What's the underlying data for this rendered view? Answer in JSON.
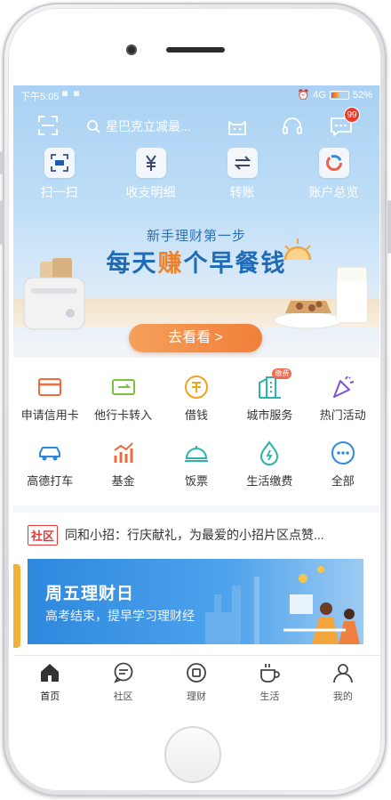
{
  "status_bar": {
    "time": "下午5:05",
    "network": "4G",
    "battery": "52%",
    "battery_level": 0.52
  },
  "header": {
    "search_placeholder": "星巴克立减最...",
    "message_badge": "99"
  },
  "quick_actions": [
    {
      "label": "扫一扫",
      "icon": "scan-card-icon"
    },
    {
      "label": "收支明细",
      "icon": "yuan-icon"
    },
    {
      "label": "转账",
      "icon": "transfer-arrows-icon"
    },
    {
      "label": "账户总览",
      "icon": "account-ring-icon"
    }
  ],
  "banner": {
    "subtitle": "新手理财第一步",
    "title_part1": "每天",
    "title_highlight": "赚",
    "title_part2": "个早餐钱",
    "cta": "去看看 >"
  },
  "services_row1": [
    {
      "label": "申请信用卡",
      "icon": "credit-card-icon",
      "color": "#f06a3c"
    },
    {
      "label": "他行卡转入",
      "icon": "card-transfer-icon",
      "color": "#7ac043"
    },
    {
      "label": "借钱",
      "icon": "borrow-icon",
      "color": "#f2a21c"
    },
    {
      "label": "城市服务",
      "icon": "city-building-icon",
      "color": "#26b5b0",
      "tag": "缴费"
    },
    {
      "label": "热门活动",
      "icon": "party-popper-icon",
      "color": "#7b54d6"
    }
  ],
  "services_row2": [
    {
      "label": "高德打车",
      "icon": "car-icon",
      "color": "#2e88de"
    },
    {
      "label": "基金",
      "icon": "fund-chart-icon",
      "color": "#f06a3c"
    },
    {
      "label": "饭票",
      "icon": "dish-cover-icon",
      "color": "#26b5a8"
    },
    {
      "label": "生活缴费",
      "icon": "water-drop-icon",
      "color": "#26b5a8"
    },
    {
      "label": "全部",
      "icon": "more-dots-icon",
      "color": "#2e88de"
    }
  ],
  "notice": {
    "tag": "社区",
    "text": "同和小招：行庆献礼，为最爱的小招片区点赞..."
  },
  "promo": {
    "title": "周五理财日",
    "subtitle": "高考结束，提早学习理财经"
  },
  "tabbar": [
    {
      "label": "首页",
      "icon": "home-icon",
      "active": true
    },
    {
      "label": "社区",
      "icon": "chat-bubble-icon",
      "active": false
    },
    {
      "label": "理财",
      "icon": "wealth-icon",
      "active": false
    },
    {
      "label": "生活",
      "icon": "coffee-cup-icon",
      "active": false
    },
    {
      "label": "我的",
      "icon": "person-icon",
      "active": false
    }
  ]
}
